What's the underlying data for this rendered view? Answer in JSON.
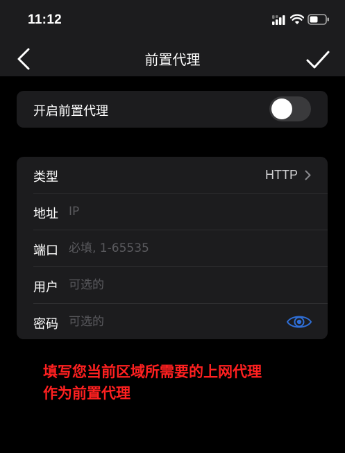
{
  "status_bar": {
    "time": "11:12"
  },
  "nav": {
    "title": "前置代理"
  },
  "toggle": {
    "label": "开启前置代理",
    "enabled": false
  },
  "form": {
    "type": {
      "label": "类型",
      "value": "HTTP"
    },
    "address": {
      "label": "地址",
      "placeholder": "IP",
      "value": ""
    },
    "port": {
      "label": "端口",
      "placeholder": "必填, 1-65535",
      "value": ""
    },
    "user": {
      "label": "用户",
      "placeholder": "可选的",
      "value": ""
    },
    "password": {
      "label": "密码",
      "placeholder": "可选的",
      "value": ""
    }
  },
  "annotation": {
    "line1": "填写您当前区域所需要的上网代理",
    "line2": "作为前置代理"
  },
  "colors": {
    "background": "#000000",
    "card": "#1c1c1e",
    "annotation": "#ff2020",
    "eye_icon": "#2f6fd8"
  },
  "icons": [
    "signal-icon",
    "wifi-icon",
    "battery-icon",
    "back-chevron-icon",
    "checkmark-icon",
    "chevron-right-icon",
    "eye-icon"
  ]
}
